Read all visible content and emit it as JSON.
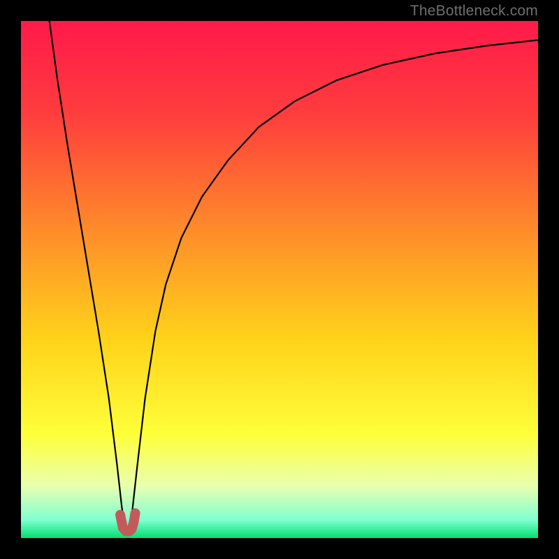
{
  "watermark": "TheBottleneck.com",
  "chart_data": {
    "type": "line",
    "title": "",
    "xlabel": "",
    "ylabel": "",
    "xlim": [
      0,
      100
    ],
    "ylim": [
      0,
      100
    ],
    "grid": false,
    "legend": false,
    "background_gradient": {
      "stops": [
        {
          "pos": 0.0,
          "color": "#ff1a4a"
        },
        {
          "pos": 0.18,
          "color": "#ff3d3d"
        },
        {
          "pos": 0.4,
          "color": "#ff8a2a"
        },
        {
          "pos": 0.62,
          "color": "#ffd41a"
        },
        {
          "pos": 0.8,
          "color": "#ffff3a"
        },
        {
          "pos": 0.9,
          "color": "#e8ffb0"
        },
        {
          "pos": 0.965,
          "color": "#80ffd0"
        },
        {
          "pos": 1.0,
          "color": "#00e070"
        }
      ]
    },
    "series": [
      {
        "name": "bottleneck-curve",
        "x": [
          5.5,
          7,
          9,
          11,
          13,
          15,
          17,
          18.6,
          19.5,
          20.2,
          20.8,
          21.5,
          22.5,
          24,
          26,
          28,
          31,
          35,
          40,
          46,
          53,
          61,
          70,
          80,
          90,
          100
        ],
        "y": [
          100,
          89,
          76,
          64,
          52,
          40,
          27,
          14,
          6,
          1.5,
          1.5,
          5,
          14,
          27,
          40,
          49,
          58,
          66,
          73,
          79.5,
          84.5,
          88.5,
          91.5,
          93.7,
          95.2,
          96.3
        ]
      },
      {
        "name": "pink-knot",
        "x": [
          19.2,
          19.7,
          20.3,
          20.9,
          21.4,
          21.8,
          22.1
        ],
        "y": [
          4.5,
          2.0,
          1.3,
          1.3,
          1.7,
          3.0,
          4.8
        ]
      }
    ],
    "colors": {
      "curve": "#000000",
      "knot": "#c35a5a"
    }
  }
}
